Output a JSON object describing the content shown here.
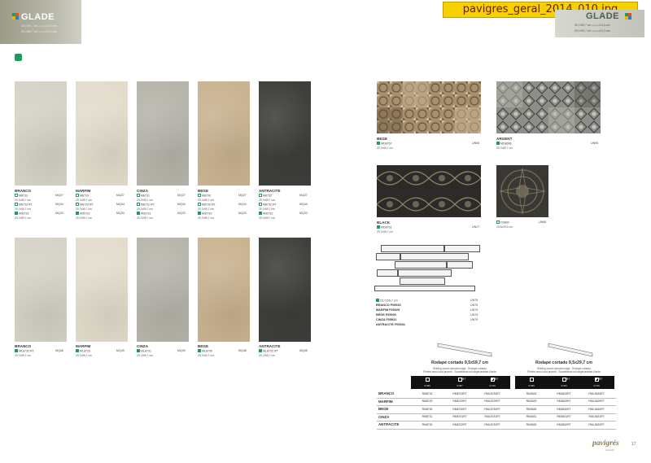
{
  "overlay_title": "pavigres_geral_2014_010.jpg",
  "brand": "GLADE",
  "brand_colors": [
    "#1f9c5a",
    "#e94e1b",
    "#f0b000",
    "#2a7fc1"
  ],
  "spec_left": [
    "30,7x59,7 cm ▭▭▭10,5 mm",
    "29,7x59,7 cm ▭▭▭10,2 mm"
  ],
  "spec_right": [
    "30,7x59,7 cm ▭▭▭10,5 mm",
    "29,7x59,7 cm ▭▭▭10,2 mm"
  ],
  "eco_icon": "leaf-icon",
  "colors": {
    "branco": "#d6d2c7",
    "marfim": "#e3dccc",
    "cinza": "#b7b5ab",
    "bege": "#c9b391",
    "antracite": "#3d3f3b"
  },
  "top_tiles": [
    {
      "name": "BRANCO",
      "lines": [
        {
          "code": "M8733",
          "value": "MQ27",
          "filled": false
        },
        {
          "caption": "29,7x59,7 cm"
        },
        {
          "code": "M8733 RT",
          "value": "MQ44",
          "filled": false
        },
        {
          "caption": "29,7x59,7 cm"
        },
        {
          "code": "A06733",
          "value": "MQ33",
          "filled": true
        },
        {
          "caption": "29,7x59,7 cm"
        }
      ]
    },
    {
      "name": "MARFIM",
      "lines": [
        {
          "code": "M8729",
          "value": "MQ27",
          "filled": false
        },
        {
          "caption": "29,7x59,7 cm"
        },
        {
          "code": "M8729 RT",
          "value": "MQ44",
          "filled": false
        },
        {
          "caption": "29,7x59,7 cm"
        },
        {
          "code": "A06729",
          "value": "MQ33",
          "filled": true
        },
        {
          "caption": "29,7x59,7 cm"
        }
      ]
    },
    {
      "name": "CINZA",
      "lines": [
        {
          "code": "M8731",
          "value": "MQ27",
          "filled": false
        },
        {
          "caption": "29,7x59,7 cm"
        },
        {
          "code": "M8731 RT",
          "value": "MQ44",
          "filled": false
        },
        {
          "caption": "29,7x59,7 cm"
        },
        {
          "code": "A06731",
          "value": "MQ33",
          "filled": true
        },
        {
          "caption": "29,7x59,7 cm"
        }
      ]
    },
    {
      "name": "BEGE",
      "lines": [
        {
          "code": "M8730",
          "value": "MQ27",
          "filled": false
        },
        {
          "caption": "29,7x59,7 cm"
        },
        {
          "code": "M8730 RT",
          "value": "MQ44",
          "filled": false
        },
        {
          "caption": "29,7x59,7 cm"
        },
        {
          "code": "A06730",
          "value": "MQ33",
          "filled": true
        },
        {
          "caption": "29,7x59,7 cm"
        }
      ]
    },
    {
      "name": "ANTRACITE",
      "lines": [
        {
          "code": "M8732",
          "value": "MQ27",
          "filled": false
        },
        {
          "caption": "29,7x59,7 cm"
        },
        {
          "code": "M8732 RT",
          "value": "MQ44",
          "filled": false
        },
        {
          "caption": "29,7x59,7 cm"
        },
        {
          "code": "A06732",
          "value": "MQ33",
          "filled": true
        },
        {
          "caption": "29,7x59,7 cm"
        }
      ]
    }
  ],
  "bottom_tiles": [
    {
      "name": "BRANCO",
      "code": "ML8733 RT",
      "value": "MQ48",
      "caption": "29,7x59,7 cm"
    },
    {
      "name": "MARFIM",
      "code": "ML8729",
      "value": "MQ49",
      "caption": "29,7x59,7 cm"
    },
    {
      "name": "CINZA",
      "code": "ML8731",
      "value": "MQ49",
      "caption": "29,7x59,7 cm"
    },
    {
      "name": "BEGE",
      "code": "ML8730",
      "value": "MQ48",
      "caption": "29,7x59,7 cm"
    },
    {
      "name": "ANTRACITE",
      "code": "ML8732 RT",
      "value": "MQ48",
      "caption": "29,7x59,7 cm"
    }
  ],
  "decor": [
    {
      "name": "BEGE",
      "code": "MD8767",
      "value": "UN95",
      "caption": "29,7x59,7 cm"
    },
    {
      "name": "ARGENT",
      "code": "MD8666",
      "value": "UN95",
      "caption": "29,7x59,7 cm"
    },
    {
      "name": "BLACK",
      "code": "MD8761",
      "value": "UN27",
      "caption": "29,7x59,7 cm"
    },
    {
      "code": "D3800",
      "value": "UN85",
      "caption": "29,5x29,5 cm"
    }
  ],
  "skirting_list": {
    "caption": "29,7x59,7 cm",
    "items": [
      {
        "label": "",
        "value": "UN79"
      },
      {
        "label": "BRANCO F05933",
        "value": "UN79"
      },
      {
        "label": "MARFIM F05929",
        "value": "UN79"
      },
      {
        "label": "BEGE F05930",
        "value": "UN79"
      },
      {
        "label": "CINZA F05931",
        "value": "UN79"
      },
      {
        "label": "ANTRACITE F05932",
        "value": ""
      }
    ]
  },
  "rodape": [
    {
      "title": "Rodapé cortado 9,5x59,7 cm",
      "sub": [
        "Skirting board rounded edge - Rodapé cortado",
        "Plinthe avec bord arrondi · Sockelleiste mit abgerundeter Kante"
      ],
      "headers": [
        {
          "top": "",
          "bot": "UN88"
        },
        {
          "top": "RT",
          "bot": "UN87"
        },
        {
          "top": "RT",
          "bot": "UN18"
        }
      ]
    },
    {
      "title": "Rodapé cortado 9,5x29,7 cm",
      "sub": [
        "Skirting board rounded edge - Rodapé cortado",
        "Plinthe avec bord arrondi · Sockelleiste mit abgerundeter Kante"
      ],
      "headers": [
        {
          "top": "",
          "bot": "UN88"
        },
        {
          "top": "RT",
          "bot": "UN33"
        },
        {
          "top": "RT",
          "bot": "UN18"
        }
      ]
    }
  ],
  "rodape_rows": [
    {
      "name": "BRANCO",
      "a": [
        "RM8733",
        "RM8733RT",
        "RML8733RT"
      ],
      "b": [
        "RM3633",
        "RM3633RT",
        "RML3633RT"
      ]
    },
    {
      "name": "MARFIM",
      "a": [
        "RM8729",
        "RM8729RT",
        "RML8729RT"
      ],
      "b": [
        "RM3629",
        "RM3629RT",
        "RML3629RT"
      ]
    },
    {
      "name": "BEGE",
      "a": [
        "RM8730",
        "RM8730RT",
        "RML8730RT"
      ],
      "b": [
        "RM3630",
        "RM3630RT",
        "RML3630RT"
      ]
    },
    {
      "name": "CINZA",
      "a": [
        "RM8731",
        "RM8731RT",
        "RML8731RT"
      ],
      "b": [
        "RM3631",
        "RM3631RT",
        "RML3631RT"
      ]
    },
    {
      "name": "ANTRACITE",
      "a": [
        "RM8732",
        "RM8732RT",
        "RML8732RT"
      ],
      "b": [
        "RM3632",
        "RM3632RT",
        "RML3632RT"
      ]
    }
  ],
  "footer": {
    "logo": "pavigrés",
    "sub": "ceramic",
    "page": "17"
  }
}
